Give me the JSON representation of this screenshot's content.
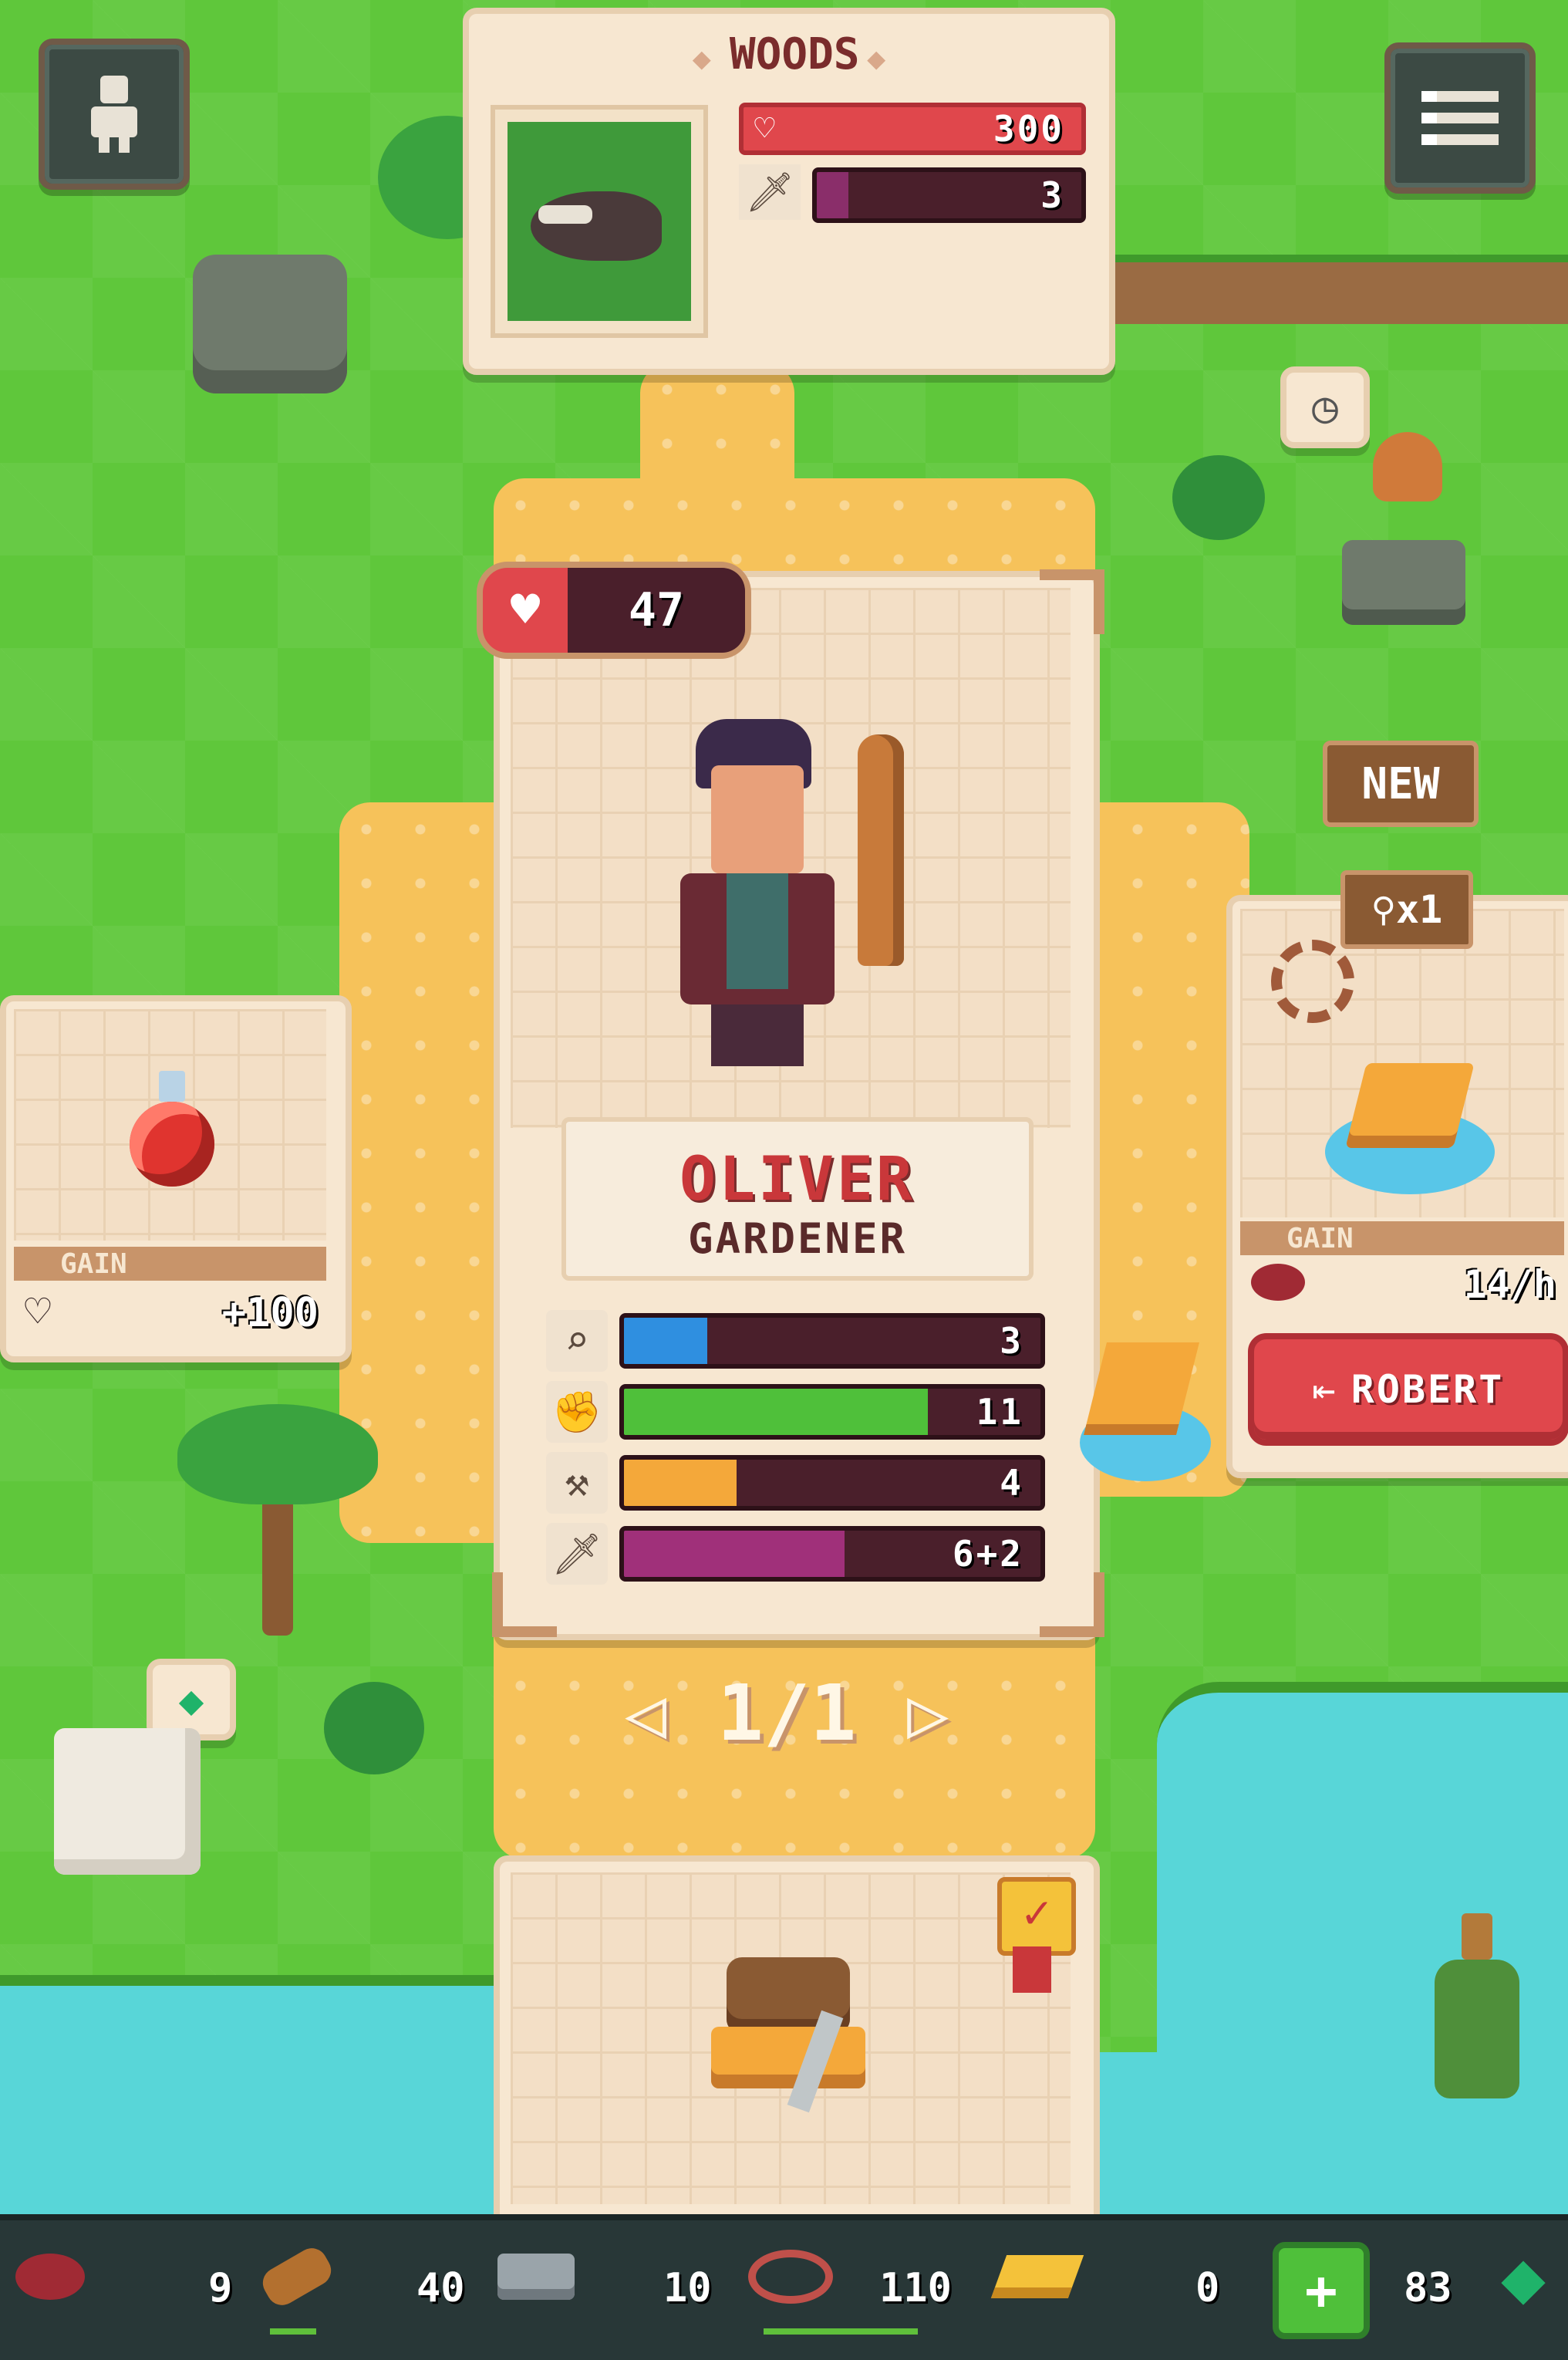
{
  "enemy": {
    "title": "WOODS",
    "health": "300",
    "attack": "3",
    "health_fraction": 1.0,
    "attack_fraction": 0.12
  },
  "hero": {
    "health": "47",
    "name": "OLIVER",
    "role": "GARDENER",
    "stats": [
      {
        "icon": "search-icon",
        "value": "3",
        "fraction": 0.2,
        "color": "#2f8fe0"
      },
      {
        "icon": "fist-icon",
        "value": "11",
        "fraction": 0.73,
        "color": "#4fc03a"
      },
      {
        "icon": "axe-icon",
        "value": "4",
        "fraction": 0.27,
        "color": "#f4a83a"
      },
      {
        "icon": "sword-icon",
        "value": "6+2",
        "fraction": 0.53,
        "color": "#a0307a"
      }
    ],
    "pager": "1/1"
  },
  "potion_card": {
    "gain_label": "GAIN",
    "gain_value": "+100"
  },
  "dock_card": {
    "new_badge": "NEW",
    "count_badge": "x1",
    "gain_label": "GAIN",
    "gain_value": "14/h",
    "robert_button": "ROBERT"
  },
  "resources": [
    {
      "name": "meat",
      "value": "9"
    },
    {
      "name": "wood",
      "value": "40"
    },
    {
      "name": "stone",
      "value": "10"
    },
    {
      "name": "rope",
      "value": "110"
    },
    {
      "name": "gold",
      "value": "0"
    },
    {
      "name": "gems",
      "value": "83"
    }
  ],
  "colors": {
    "health_red": "#e0474c",
    "attack_purple": "#8a2e6a",
    "name_red": "#c9373a"
  }
}
